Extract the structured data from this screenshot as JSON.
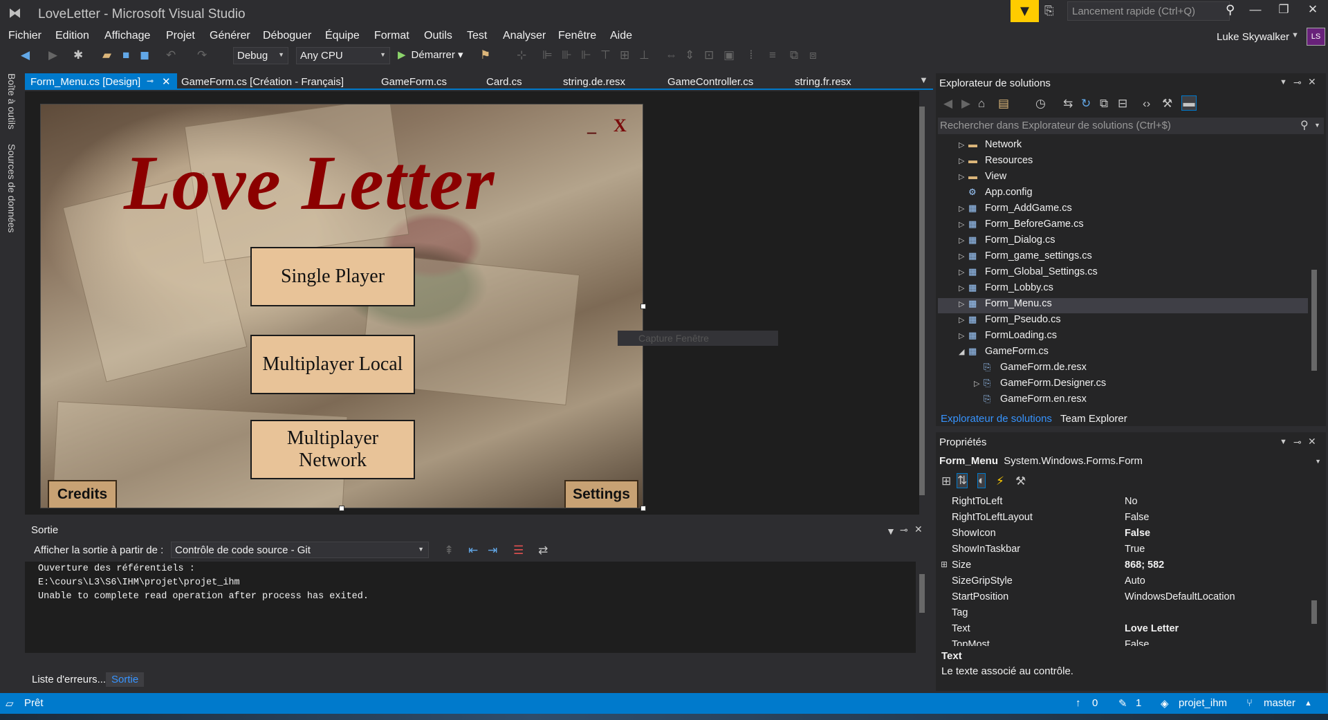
{
  "window": {
    "title": "LoveLetter - Microsoft Visual Studio",
    "quick_launch_placeholder": "Lancement rapide (Ctrl+Q)",
    "user_name": "Luke Skywalker",
    "avatar_initials": "LS"
  },
  "menu": [
    "Fichier",
    "Edition",
    "Affichage",
    "Projet",
    "Générer",
    "Déboguer",
    "Équipe",
    "Format",
    "Outils",
    "Test",
    "Analyser",
    "Fenêtre",
    "Aide"
  ],
  "toolbar": {
    "configuration": "Debug",
    "platform": "Any CPU",
    "start_label": "Démarrer"
  },
  "left_rail": [
    "Boîte à outils",
    "Sources de données"
  ],
  "doc_tabs": [
    {
      "label": "Form_Menu.cs [Design]",
      "active": true
    },
    {
      "label": "GameForm.cs [Création - Français]"
    },
    {
      "label": "GameForm.cs"
    },
    {
      "label": "Card.cs"
    },
    {
      "label": "string.de.resx"
    },
    {
      "label": "GameController.cs"
    },
    {
      "label": "string.fr.resx"
    }
  ],
  "designer": {
    "game_title": "Love Letter",
    "minimize": "_",
    "close": "X",
    "buttons": [
      "Single Player",
      "Multiplayer Local",
      "Multiplayer Network"
    ],
    "credits": "Credits",
    "settings": "Settings",
    "capture_ghost": "Capture Fenêtre"
  },
  "output": {
    "title": "Sortie",
    "from_label": "Afficher la sortie à partir de :",
    "source": "Contrôle de code source - Git",
    "lines": [
      "Ouverture des référentiels :",
      "E:\\cours\\L3\\S6\\IHM\\projet\\projet_ihm",
      "Unable to complete read operation after process has exited."
    ],
    "tabs": [
      "Liste d'erreurs...",
      "Sortie"
    ]
  },
  "solution_explorer": {
    "title": "Explorateur de solutions",
    "search_placeholder": "Rechercher dans Explorateur de solutions (Ctrl+$)",
    "items": [
      {
        "label": "Network",
        "kind": "folder",
        "expander": "▷",
        "indent": 0
      },
      {
        "label": "Resources",
        "kind": "folder",
        "expander": "▷",
        "indent": 0
      },
      {
        "label": "View",
        "kind": "folder",
        "expander": "▷",
        "indent": 0
      },
      {
        "label": "App.config",
        "kind": "config",
        "expander": "",
        "indent": 0
      },
      {
        "label": "Form_AddGame.cs",
        "kind": "form",
        "expander": "▷",
        "indent": 0
      },
      {
        "label": "Form_BeforeGame.cs",
        "kind": "form",
        "expander": "▷",
        "indent": 0
      },
      {
        "label": "Form_Dialog.cs",
        "kind": "form",
        "expander": "▷",
        "indent": 0
      },
      {
        "label": "Form_game_settings.cs",
        "kind": "form",
        "expander": "▷",
        "indent": 0
      },
      {
        "label": "Form_Global_Settings.cs",
        "kind": "form",
        "expander": "▷",
        "indent": 0
      },
      {
        "label": "Form_Lobby.cs",
        "kind": "form",
        "expander": "▷",
        "indent": 0
      },
      {
        "label": "Form_Menu.cs",
        "kind": "form",
        "expander": "▷",
        "indent": 0,
        "selected": true
      },
      {
        "label": "Form_Pseudo.cs",
        "kind": "form",
        "expander": "▷",
        "indent": 0
      },
      {
        "label": "FormLoading.cs",
        "kind": "form",
        "expander": "▷",
        "indent": 0
      },
      {
        "label": "GameForm.cs",
        "kind": "form",
        "expander": "◢",
        "indent": 0
      },
      {
        "label": "GameForm.de.resx",
        "kind": "resx",
        "expander": "",
        "indent": 1
      },
      {
        "label": "GameForm.Designer.cs",
        "kind": "resx",
        "expander": "▷",
        "indent": 1
      },
      {
        "label": "GameForm.en.resx",
        "kind": "resx",
        "expander": "",
        "indent": 1
      }
    ],
    "tabs": [
      "Explorateur de solutions",
      "Team Explorer"
    ]
  },
  "properties": {
    "title": "Propriétés",
    "object_name": "Form_Menu",
    "object_type": "System.Windows.Forms.Form",
    "rows": [
      {
        "name": "RightToLeft",
        "value": "No"
      },
      {
        "name": "RightToLeftLayout",
        "value": "False"
      },
      {
        "name": "ShowIcon",
        "value": "False",
        "bold": true
      },
      {
        "name": "ShowInTaskbar",
        "value": "True"
      },
      {
        "name": "Size",
        "value": "868; 582",
        "bold": true,
        "expandable": true
      },
      {
        "name": "SizeGripStyle",
        "value": "Auto"
      },
      {
        "name": "StartPosition",
        "value": "WindowsDefaultLocation"
      },
      {
        "name": "Tag",
        "value": ""
      },
      {
        "name": "Text",
        "value": "Love Letter",
        "bold": true
      },
      {
        "name": "TopMost",
        "value": "False"
      }
    ],
    "desc_title": "Text",
    "desc_text": "Le texte associé au contrôle."
  },
  "statusbar": {
    "ready": "Prêt",
    "pushes": "0",
    "changes": "1",
    "repo": "projet_ihm",
    "branch": "master"
  },
  "colors": {
    "accent": "#007acc",
    "game_title": "#8b0000",
    "form_button": "#e8c398"
  }
}
